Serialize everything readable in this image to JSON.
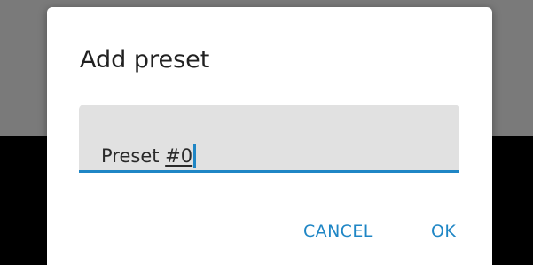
{
  "dialog": {
    "title": "Add preset",
    "input": {
      "value_prefix": "Preset ",
      "value_composing": "#0",
      "focused": true
    },
    "buttons": {
      "cancel_label": "CANCEL",
      "ok_label": "OK"
    }
  },
  "colors": {
    "accent": "#1f86c5",
    "dialog_background": "#ffffff",
    "field_background": "#e1e1e1",
    "scrim_top": "#7a7a7a",
    "scrim_bottom": "#000000",
    "text_primary": "#212121"
  }
}
